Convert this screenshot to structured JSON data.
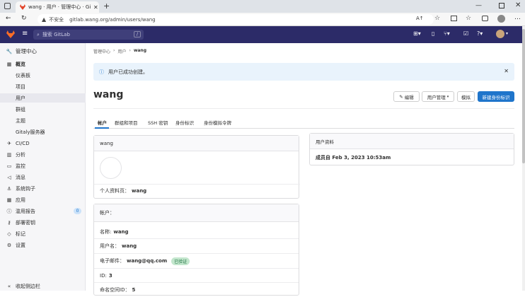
{
  "browser": {
    "tab_title": "wang · 用户 · 管理中心 · GitLab",
    "url_security": "不安全",
    "url": "gitlab.wang.org/admin/users/wang",
    "window_controls": [
      "minimize",
      "maximize",
      "close"
    ]
  },
  "topnav": {
    "search_placeholder": "搜索 GitLab",
    "search_shortcut": "/"
  },
  "sidebar": {
    "title": "管理中心",
    "overview": "概览",
    "items": [
      {
        "label": "仪表板"
      },
      {
        "label": "项目"
      },
      {
        "label": "用户"
      },
      {
        "label": "群组"
      },
      {
        "label": "主题"
      },
      {
        "label": "Gitaly服务器"
      }
    ],
    "sections": [
      {
        "label": "CI/CD",
        "icon": "rocket-icon"
      },
      {
        "label": "分析",
        "icon": "chart-icon"
      },
      {
        "label": "监控",
        "icon": "monitor-icon"
      },
      {
        "label": "消息",
        "icon": "bullhorn-icon"
      },
      {
        "label": "系统钩子",
        "icon": "hook-icon"
      },
      {
        "label": "应用",
        "icon": "grid-icon"
      },
      {
        "label": "滥用报告",
        "icon": "alert-icon",
        "badge": "0"
      },
      {
        "label": "部署密钥",
        "icon": "key-icon"
      },
      {
        "label": "标记",
        "icon": "tag-icon"
      },
      {
        "label": "设置",
        "icon": "gear-icon"
      }
    ],
    "collapse_label": "收起侧边栏"
  },
  "main": {
    "breadcrumb": [
      "管理中心",
      "用户",
      "wang"
    ],
    "alert": "用户已成功创建。",
    "user_title": "wang",
    "buttons": {
      "edit": "编辑",
      "user_admin": "用户管理",
      "impersonate": "模拟",
      "new_token": "新建身份标识"
    },
    "tabs": [
      "帐户",
      "群组和项目",
      "SSH 密钥",
      "身份标识",
      "身份模拟令牌"
    ],
    "profile_card": {
      "header": "wang",
      "profile_label": "个人资料页：",
      "profile_value": "wang"
    },
    "account_card": {
      "header": "帐户：",
      "rows": [
        {
          "label": "名称:",
          "value": "wang"
        },
        {
          "label": "用户名：",
          "value": "wang"
        },
        {
          "label": "电子邮件：",
          "value": "wang@qq.com",
          "badge": "已验证"
        },
        {
          "label": "ID:",
          "value": "3"
        },
        {
          "label": "命名空间ID：",
          "value": "5"
        }
      ]
    },
    "info_card": {
      "header": "用户资料",
      "member_since": "成员自 Feb 3, 2023 10:53am"
    }
  }
}
